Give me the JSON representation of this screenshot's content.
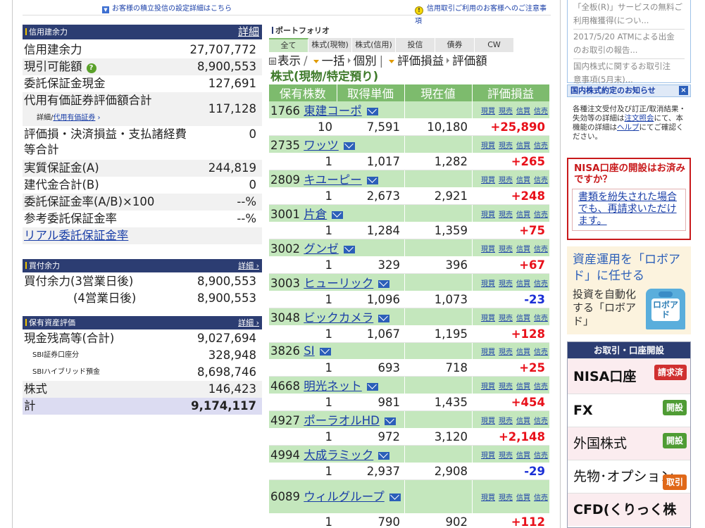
{
  "top_notices": {
    "left": "お客様の積立投信の設定詳細はこちら",
    "right": "信用取引ご利用のお客様へのご注意事項"
  },
  "credit_panel": {
    "title": "信用建余力",
    "detail_link": "詳細",
    "rows": [
      {
        "label": "信用建余力",
        "value": "27,707,772"
      },
      {
        "label": "現引可能額",
        "value": "8,900,553"
      },
      {
        "label": "委託保証金現金",
        "value": "127,691"
      },
      {
        "label": "代用有価証券評価額合計",
        "value": "117,128"
      },
      {
        "label": "評価損・決済損益・支払諸経費",
        "label2": "等合計",
        "value": "0"
      },
      {
        "label": "実質保証金(A)",
        "value": "244,819"
      },
      {
        "label": "建代金合計(B)",
        "value": "0"
      },
      {
        "label": "委託保証金率(A/B)×100",
        "value": "--%"
      },
      {
        "label": "参考委託保証金率",
        "value": "--%"
      }
    ],
    "sub_link_prefix": "詳細/",
    "sub_link": "代用有価証券",
    "real_rate_link": "リアル委託保証金率"
  },
  "buying_panel": {
    "title": "買付余力",
    "detail_link": "詳細",
    "rows": [
      {
        "label": "買付余力(3営業日後)",
        "value": "8,900,553"
      },
      {
        "label": "(4営業日後)",
        "value": "8,900,553"
      }
    ]
  },
  "assets_panel": {
    "title": "保有資産評価",
    "detail_link": "詳細",
    "rows": [
      {
        "label": "現金残高等(合計)",
        "value": "9,027,694"
      },
      {
        "label": "SBI証券口座分",
        "value": "328,948"
      },
      {
        "label": "SBIハイブリッド預金",
        "value": "8,698,746"
      },
      {
        "label": "株式",
        "value": "146,423"
      },
      {
        "label": "計",
        "value": "9,174,117"
      }
    ]
  },
  "portfolio": {
    "title": "ポートフォリオ",
    "tabs": [
      "全て",
      "株式(現物)",
      "株式(信用)",
      "投信",
      "債券",
      "CW"
    ],
    "view": {
      "display": "表示",
      "sep": "/",
      "all": "一括",
      "each": "個別",
      "bar": "|",
      "pl": "評価損益",
      "amount": "評価額"
    },
    "section": "株式(現物/特定預り)",
    "columns": [
      "保有株数",
      "取得単価",
      "現在値",
      "評価損益"
    ],
    "actions": [
      "現買",
      "現売",
      "信買",
      "信売"
    ],
    "holdings": [
      {
        "code": "1766",
        "name": "東建コーポ",
        "shares": "10",
        "cost": "7,591",
        "price": "10,180",
        "pl": "+25,890",
        "pl_color": "#e8101a"
      },
      {
        "code": "2735",
        "name": "ワッツ",
        "shares": "1",
        "cost": "1,017",
        "price": "1,282",
        "pl": "+265",
        "pl_color": "#e8101a"
      },
      {
        "code": "2809",
        "name": "キユーピー",
        "shares": "1",
        "cost": "2,673",
        "price": "2,921",
        "pl": "+248",
        "pl_color": "#e8101a"
      },
      {
        "code": "3001",
        "name": "片倉",
        "shares": "1",
        "cost": "1,284",
        "price": "1,359",
        "pl": "+75",
        "pl_color": "#e8101a"
      },
      {
        "code": "3002",
        "name": "グンゼ",
        "shares": "1",
        "cost": "329",
        "price": "396",
        "pl": "+67",
        "pl_color": "#e8101a"
      },
      {
        "code": "3003",
        "name": "ヒューリック",
        "shares": "1",
        "cost": "1,096",
        "price": "1,073",
        "pl": "-23",
        "pl_color": "#1a2fd6"
      },
      {
        "code": "3048",
        "name": "ビックカメラ",
        "shares": "1",
        "cost": "1,067",
        "price": "1,195",
        "pl": "+128",
        "pl_color": "#e8101a"
      },
      {
        "code": "3826",
        "name": "SI",
        "shares": "1",
        "cost": "693",
        "price": "718",
        "pl": "+25",
        "pl_color": "#e8101a"
      },
      {
        "code": "4668",
        "name": "明光ネット",
        "shares": "1",
        "cost": "981",
        "price": "1,435",
        "pl": "+454",
        "pl_color": "#e8101a"
      },
      {
        "code": "4927",
        "name": "ポーラオルHD",
        "shares": "1",
        "cost": "972",
        "price": "3,120",
        "pl": "+2,148",
        "pl_color": "#e8101a"
      },
      {
        "code": "4994",
        "name": "大成ラミック",
        "shares": "1",
        "cost": "2,937",
        "price": "2,908",
        "pl": "-29",
        "pl_color": "#1a2fd6"
      },
      {
        "code": "6089",
        "name": "ウィルグループ",
        "shares": "1",
        "cost": "790",
        "price": "902",
        "pl": "+112",
        "pl_color": "#e8101a"
      }
    ]
  },
  "sidebar": {
    "news": [
      "「全板(R)」サービスの無料ご",
      "利用権獲得(につい...",
      "2017/5/20 ATMによる出金",
      "のお取引の報告...",
      "国内株式に関するお取引注",
      "意事項(5月末)..."
    ],
    "notice_title": "国内株式約定のお知らせ",
    "notice_close": "×",
    "notice_text_1": "各種注文受付及び訂正/取消結果・失効等の詳細は",
    "notice_link_1": "注文照会",
    "notice_text_2": "にて、本機能の詳細は",
    "notice_link_2": "ヘルプ",
    "notice_text_3": "にてご確認ください。",
    "nisa_title": "NISA口座の開設はお済みですか？",
    "nisa_link": "書類を紛失された場合でも、再請求いただけます。",
    "robo_title": "資産運用を「ロボアド」に任せる",
    "robo_text": "投資を自動化する「ロボアド」",
    "robo_icon_text": "ロボアド",
    "acct_title": "お取引・口座開設",
    "acct_items": [
      {
        "label": "NISA口座",
        "button": "請求済"
      },
      {
        "label": "FX",
        "button": "開設"
      },
      {
        "label": "外国株式",
        "button": "開設"
      },
      {
        "label": "先物･オプション",
        "button": "取引"
      },
      {
        "label": "CFD(くりっく株"
      }
    ]
  },
  "colors": {
    "header_navy": "#2c3d72",
    "portfolio_green": "#7dbb6d",
    "row_green": "#c4e7bd",
    "gain_red": "#e8101a",
    "loss_blue": "#1a2fd6"
  }
}
